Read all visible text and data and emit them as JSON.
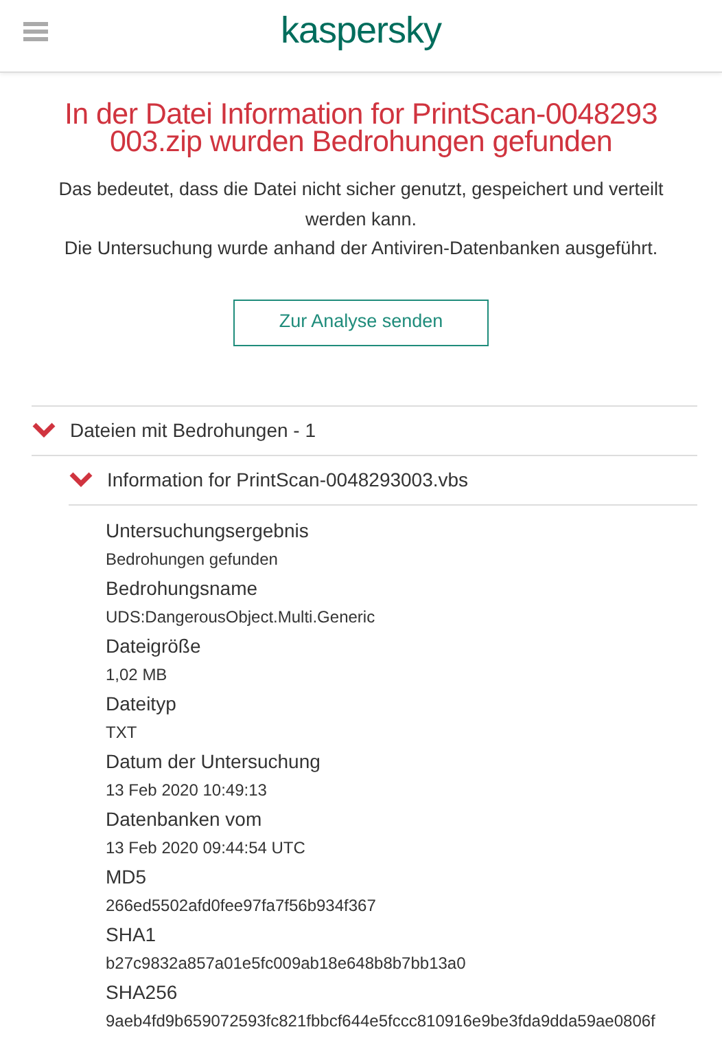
{
  "header": {
    "logo": "kaspersky"
  },
  "title": "In der Datei Information for PrintScan-0048293 003.zip wurden Bedrohungen gefunden",
  "description": [
    "Das bedeutet, dass die Datei nicht sicher genutzt, gespeichert und verteilt werden kann.",
    "Die Untersuchung wurde anhand der Antiviren-Datenbanken ausgeführt."
  ],
  "action_button": "Zur Analyse senden",
  "tree": {
    "label": "Dateien mit Bedrohungen - 1",
    "expanded": true,
    "children": [
      {
        "label": "Information for PrintScan-0048293003.vbs",
        "expanded": true,
        "details": [
          {
            "label": "Untersuchungsergebnis",
            "value": "Bedrohungen gefunden"
          },
          {
            "label": "Bedrohungsname",
            "value": "UDS:DangerousObject.Multi.Generic"
          },
          {
            "label": "Dateigröße",
            "value": "1,02 MB"
          },
          {
            "label": "Dateityp",
            "value": "TXT"
          },
          {
            "label": "Datum der Untersuchung",
            "value": "13 Feb 2020 10:49:13"
          },
          {
            "label": "Datenbanken vom",
            "value": "13 Feb 2020 09:44:54 UTC"
          },
          {
            "label": "MD5",
            "value": "266ed5502afd0fee97fa7f56b934f367"
          },
          {
            "label": "SHA1",
            "value": "b27c9832a857a01e5fc009ab18e648b8b7bb13a0"
          },
          {
            "label": "SHA256",
            "value": "9aeb4fd9b659072593fc821fbbcf644e5fccc810916e9be3fda9dda59ae0806f"
          }
        ]
      }
    ]
  }
}
